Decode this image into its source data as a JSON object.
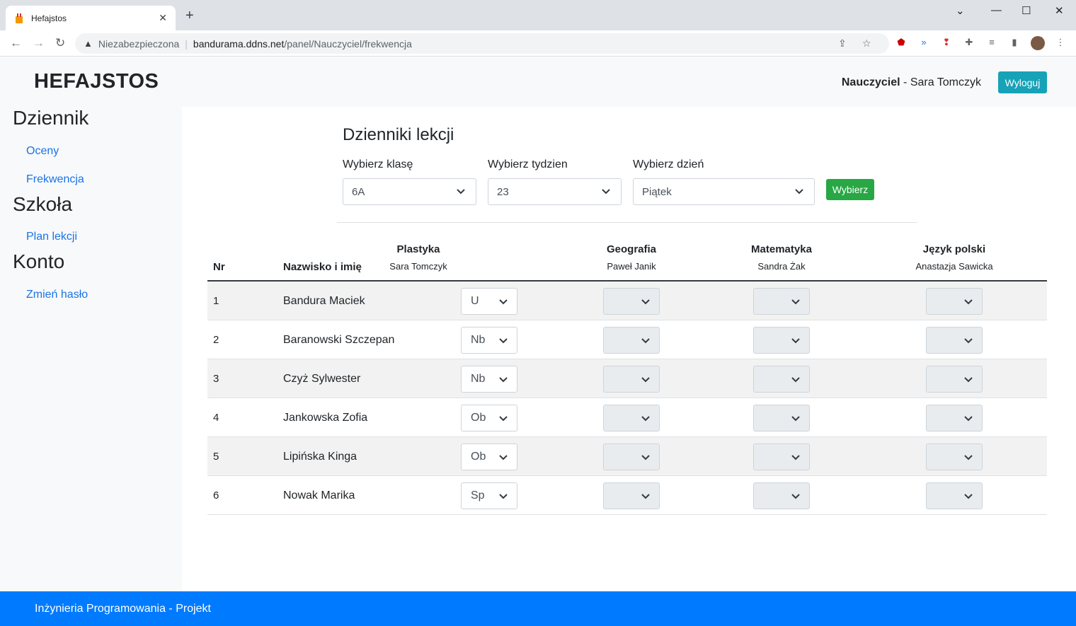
{
  "browser": {
    "tab_title": "Hefajstos",
    "insecure_label": "Niezabezpieczona",
    "url_host": "bandurama.ddns.net",
    "url_path": "/panel/Nauczyciel/frekwencja"
  },
  "header": {
    "brand": "HEFAJSTOS",
    "role": "Nauczyciel",
    "user_name": " - Sara Tomczyk",
    "logout": "Wyloguj"
  },
  "sidebar": {
    "sections": [
      {
        "title": "Dziennik",
        "items": [
          "Oceny",
          "Frekwencja"
        ]
      },
      {
        "title": "Szkoła",
        "items": [
          "Plan lekcji"
        ]
      },
      {
        "title": "Konto",
        "items": [
          "Zmień hasło"
        ]
      }
    ]
  },
  "main": {
    "title": "Dzienniki lekcji",
    "filters": {
      "class_label": "Wybierz klasę",
      "class_value": "6A",
      "week_label": "Wybierz tydzien",
      "week_value": "23",
      "day_label": "Wybierz dzień",
      "day_value": "Piątek",
      "submit": "Wybierz"
    },
    "table": {
      "col_nr": "Nr",
      "col_name": "Nazwisko i imię",
      "subjects": [
        {
          "name": "Plastyka",
          "teacher": "Sara Tomczyk"
        },
        {
          "name": "Geografia",
          "teacher": "Paweł Janik"
        },
        {
          "name": "Matematyka",
          "teacher": "Sandra Żak"
        },
        {
          "name": "Język polski",
          "teacher": "Anastazja Sawicka"
        }
      ],
      "rows": [
        {
          "nr": "1",
          "name": "Bandura Maciek",
          "plastyka": "U"
        },
        {
          "nr": "2",
          "name": "Baranowski Szczepan",
          "plastyka": "Nb"
        },
        {
          "nr": "3",
          "name": "Czyż Sylwester",
          "plastyka": "Nb"
        },
        {
          "nr": "4",
          "name": "Jankowska Zofia",
          "plastyka": "Ob"
        },
        {
          "nr": "5",
          "name": "Lipińska Kinga",
          "plastyka": "Ob"
        },
        {
          "nr": "6",
          "name": "Nowak Marika",
          "plastyka": "Sp"
        }
      ]
    }
  },
  "footer": {
    "text": "Inżynieria Programowania - Projekt"
  },
  "colors": {
    "accent": "#007bff",
    "logout": "#17a2b8",
    "submit": "#28a745"
  }
}
